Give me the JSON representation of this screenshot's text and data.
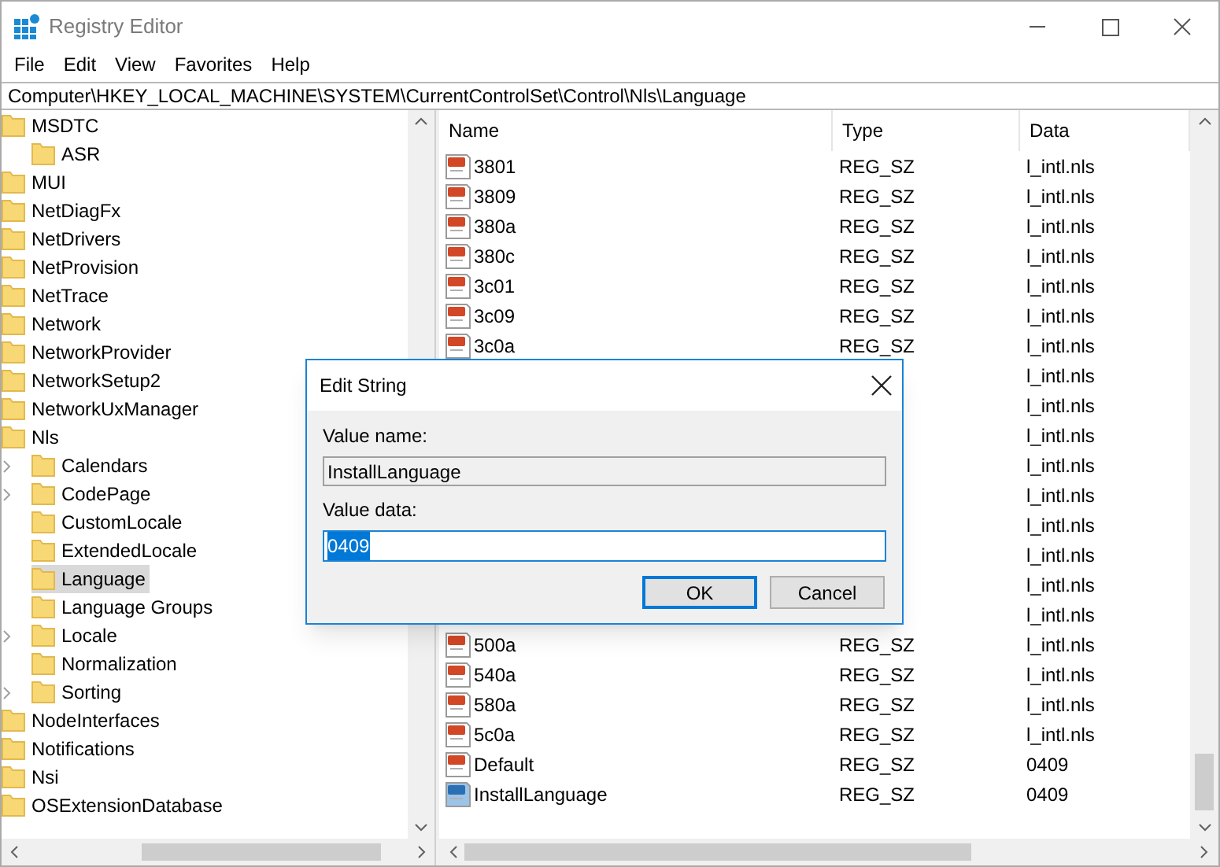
{
  "window": {
    "title": "Registry Editor"
  },
  "menu": [
    "File",
    "Edit",
    "View",
    "Favorites",
    "Help"
  ],
  "address": "Computer\\HKEY_LOCAL_MACHINE\\SYSTEM\\CurrentControlSet\\Control\\Nls\\Language",
  "tree": {
    "items": [
      {
        "label": "MSDTC",
        "selected": false,
        "children": [
          {
            "label": "ASR",
            "selected": false,
            "expandable": false
          }
        ]
      },
      {
        "label": "MUI",
        "selected": false
      },
      {
        "label": "NetDiagFx",
        "selected": false
      },
      {
        "label": "NetDrivers",
        "selected": false
      },
      {
        "label": "NetProvision",
        "selected": false
      },
      {
        "label": "NetTrace",
        "selected": false
      },
      {
        "label": "Network",
        "selected": false
      },
      {
        "label": "NetworkProvider",
        "selected": false
      },
      {
        "label": "NetworkSetup2",
        "selected": false
      },
      {
        "label": "NetworkUxManager",
        "selected": false
      },
      {
        "label": "Nls",
        "selected": false,
        "children": [
          {
            "label": "Calendars",
            "selected": false,
            "expandable": true
          },
          {
            "label": "CodePage",
            "selected": false,
            "expandable": true
          },
          {
            "label": "CustomLocale",
            "selected": false,
            "expandable": false
          },
          {
            "label": "ExtendedLocale",
            "selected": false,
            "expandable": false
          },
          {
            "label": "Language",
            "selected": true,
            "expandable": false
          },
          {
            "label": "Language Groups",
            "selected": false,
            "expandable": false
          },
          {
            "label": "Locale",
            "selected": false,
            "expandable": true
          },
          {
            "label": "Normalization",
            "selected": false,
            "expandable": false
          },
          {
            "label": "Sorting",
            "selected": false,
            "expandable": true
          }
        ]
      },
      {
        "label": "NodeInterfaces",
        "selected": false
      },
      {
        "label": "Notifications",
        "selected": false
      },
      {
        "label": "Nsi",
        "selected": false
      },
      {
        "label": "OSExtensionDatabase",
        "selected": false
      }
    ]
  },
  "values": {
    "columns": [
      "Name",
      "Type",
      "Data"
    ],
    "rows": [
      {
        "name": "3801",
        "type": "REG_SZ",
        "data": "l_intl.nls",
        "selected": false
      },
      {
        "name": "3809",
        "type": "REG_SZ",
        "data": "l_intl.nls",
        "selected": false
      },
      {
        "name": "380a",
        "type": "REG_SZ",
        "data": "l_intl.nls",
        "selected": false
      },
      {
        "name": "380c",
        "type": "REG_SZ",
        "data": "l_intl.nls",
        "selected": false
      },
      {
        "name": "3c01",
        "type": "REG_SZ",
        "data": "l_intl.nls",
        "selected": false
      },
      {
        "name": "3c09",
        "type": "REG_SZ",
        "data": "l_intl.nls",
        "selected": false
      },
      {
        "name": "3c0a",
        "type": "REG_SZ",
        "data": "l_intl.nls",
        "selected": false
      },
      {
        "data": "l_intl.nls"
      },
      {
        "data": "l_intl.nls"
      },
      {
        "data": "l_intl.nls"
      },
      {
        "data": "l_intl.nls"
      },
      {
        "data": "l_intl.nls"
      },
      {
        "data": "l_intl.nls"
      },
      {
        "data": "l_intl.nls"
      },
      {
        "data": "l_intl.nls"
      },
      {
        "data": "l_intl.nls"
      },
      {
        "name": "500a",
        "type": "REG_SZ",
        "data": "l_intl.nls",
        "selected": false
      },
      {
        "name": "540a",
        "type": "REG_SZ",
        "data": "l_intl.nls",
        "selected": false
      },
      {
        "name": "580a",
        "type": "REG_SZ",
        "data": "l_intl.nls",
        "selected": false
      },
      {
        "name": "5c0a",
        "type": "REG_SZ",
        "data": "l_intl.nls",
        "selected": false
      },
      {
        "name": "Default",
        "type": "REG_SZ",
        "data": "0409",
        "selected": false
      },
      {
        "name": "InstallLanguage",
        "type": "REG_SZ",
        "data": "0409",
        "selected": true
      }
    ]
  },
  "dialog": {
    "title": "Edit String",
    "name_label": "Value name:",
    "name_value": "InstallLanguage",
    "data_label": "Value data:",
    "data_value": "0409",
    "buttons": [
      {
        "label": "OK",
        "focused": true
      },
      {
        "label": "Cancel",
        "focused": false
      }
    ]
  }
}
